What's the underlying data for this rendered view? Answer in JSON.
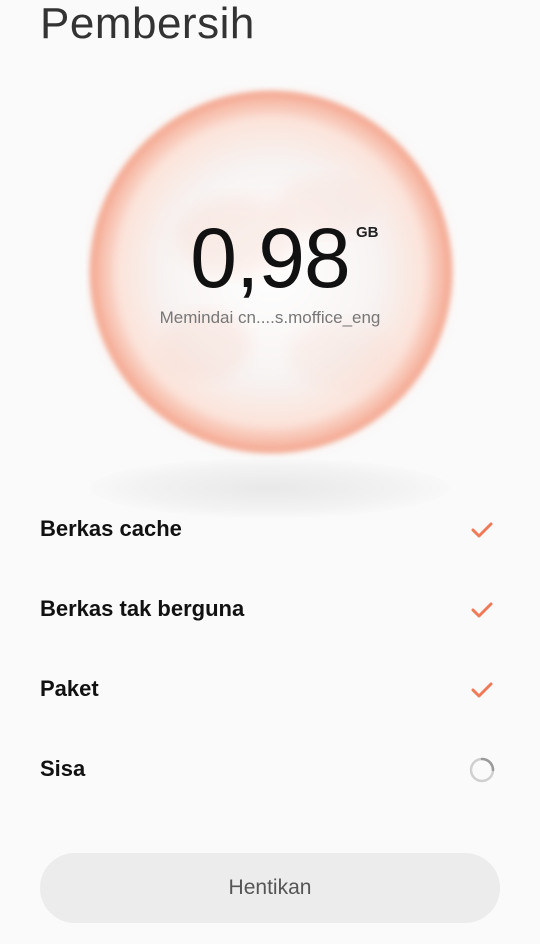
{
  "header": {
    "title": "Pembersih"
  },
  "scan": {
    "size_value": "0,98",
    "size_unit": "GB",
    "status_text": "Memindai cn....s.moffice_eng"
  },
  "colors": {
    "accent": "#ef7a5a",
    "spinner": "#c8c8c8",
    "button_bg": "#ececec"
  },
  "items": [
    {
      "label": "Berkas cache",
      "status": "done",
      "icon": "checkmark-icon"
    },
    {
      "label": "Berkas tak berguna",
      "status": "done",
      "icon": "checkmark-icon"
    },
    {
      "label": "Paket",
      "status": "done",
      "icon": "checkmark-icon"
    },
    {
      "label": "Sisa",
      "status": "scanning",
      "icon": "spinner-icon"
    }
  ],
  "actions": {
    "stop_label": "Hentikan"
  }
}
